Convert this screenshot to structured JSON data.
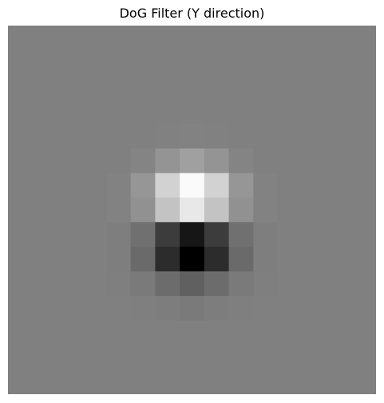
{
  "chart_data": {
    "type": "heatmap",
    "title": "DoG Filter (Y direction)",
    "xlabel": "",
    "ylabel": "",
    "axes_visible": false,
    "colormap": "gray",
    "vmin": 0,
    "vmax": 255,
    "rows": 15,
    "cols": 15,
    "values": [
      [
        128,
        128,
        128,
        128,
        128,
        128,
        128,
        128,
        128,
        128,
        128,
        128,
        128,
        128,
        128
      ],
      [
        128,
        128,
        128,
        128,
        128,
        128,
        128,
        128,
        128,
        128,
        128,
        128,
        128,
        128,
        128
      ],
      [
        128,
        128,
        128,
        128,
        128,
        128,
        128,
        128,
        128,
        128,
        128,
        128,
        128,
        128,
        128
      ],
      [
        128,
        128,
        128,
        128,
        128,
        128,
        128,
        128,
        128,
        128,
        128,
        128,
        128,
        128,
        128
      ],
      [
        128,
        128,
        128,
        128,
        128,
        128,
        129,
        130,
        129,
        128,
        128,
        128,
        128,
        128,
        128
      ],
      [
        128,
        128,
        128,
        128,
        128,
        132,
        148,
        160,
        148,
        132,
        128,
        128,
        128,
        128,
        128
      ],
      [
        128,
        128,
        128,
        128,
        130,
        150,
        210,
        250,
        210,
        150,
        130,
        128,
        128,
        128,
        128
      ],
      [
        128,
        128,
        128,
        128,
        130,
        145,
        195,
        232,
        195,
        145,
        130,
        128,
        128,
        128,
        128
      ],
      [
        128,
        128,
        128,
        128,
        126,
        112,
        60,
        22,
        60,
        112,
        126,
        128,
        128,
        128,
        128
      ],
      [
        128,
        128,
        128,
        128,
        126,
        106,
        44,
        0,
        44,
        106,
        126,
        128,
        128,
        128,
        128
      ],
      [
        128,
        128,
        128,
        128,
        127,
        122,
        108,
        96,
        108,
        122,
        127,
        128,
        128,
        128,
        128
      ],
      [
        128,
        128,
        128,
        128,
        128,
        127,
        125,
        122,
        125,
        127,
        128,
        128,
        128,
        128,
        128
      ],
      [
        128,
        128,
        128,
        128,
        128,
        128,
        128,
        128,
        128,
        128,
        128,
        128,
        128,
        128,
        128
      ],
      [
        128,
        128,
        128,
        128,
        128,
        128,
        128,
        128,
        128,
        128,
        128,
        128,
        128,
        128,
        128
      ],
      [
        128,
        128,
        128,
        128,
        128,
        128,
        128,
        128,
        128,
        128,
        128,
        128,
        128,
        128,
        128
      ]
    ]
  }
}
